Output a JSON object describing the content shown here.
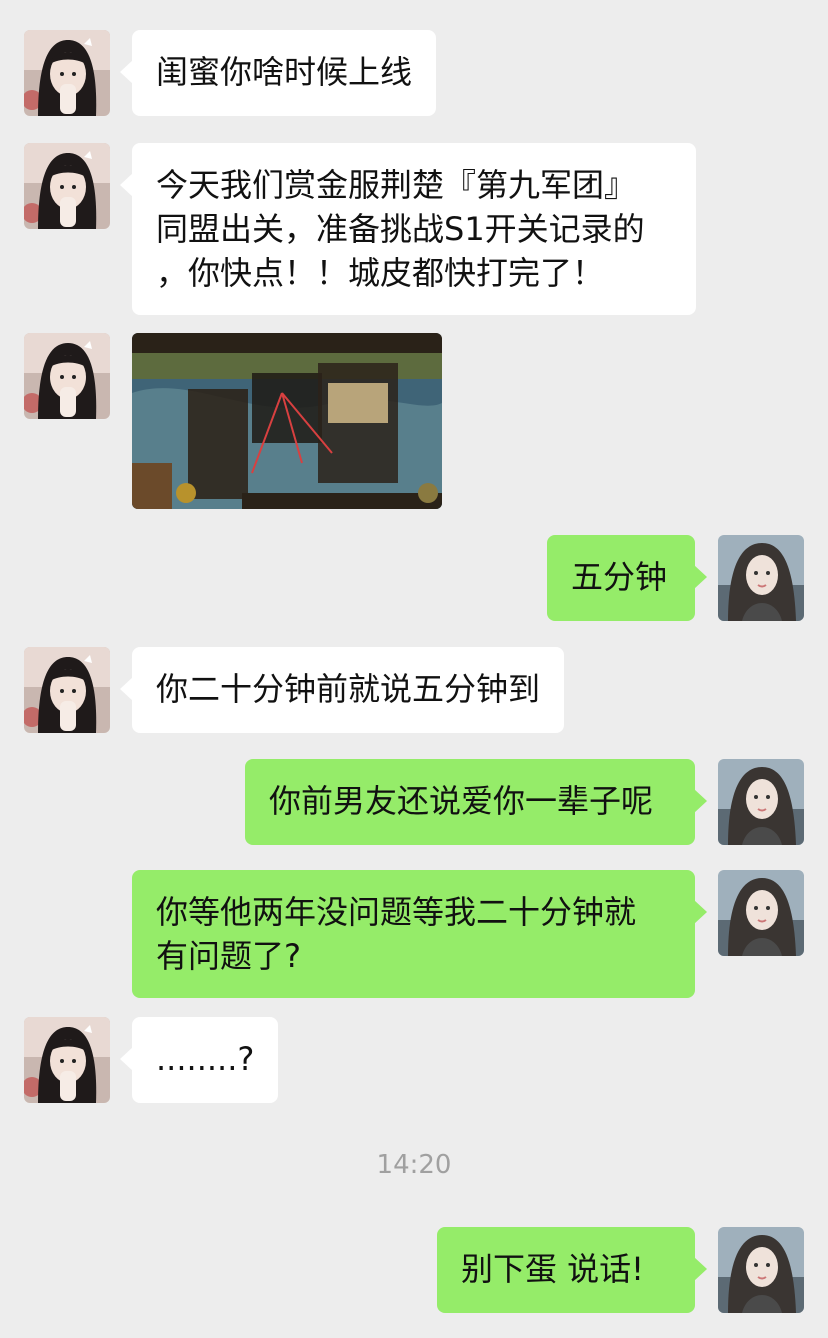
{
  "messages": [
    {
      "text": "闺蜜你啥时候上线"
    },
    {
      "text": "今天我们赏金服荆楚『第九军团』\n同盟出关，准备挑战S1开关记录的\n，你快点！！城皮都快打完了！"
    },
    {
      "image": "game-screenshot"
    },
    {
      "text": "五分钟"
    },
    {
      "text": "你二十分钟前就说五分钟到"
    },
    {
      "text": "你前男友还说爱你一辈子呢"
    },
    {
      "text": "你等他两年没问题等我二十分钟就\n有问题了?"
    },
    {
      "text": "........?"
    },
    {
      "text": "别下蛋 说话!"
    }
  ],
  "timestamp": "14:20",
  "colors": {
    "background": "#ededed",
    "incoming": "#ffffff",
    "outgoing": "#95ec69"
  }
}
